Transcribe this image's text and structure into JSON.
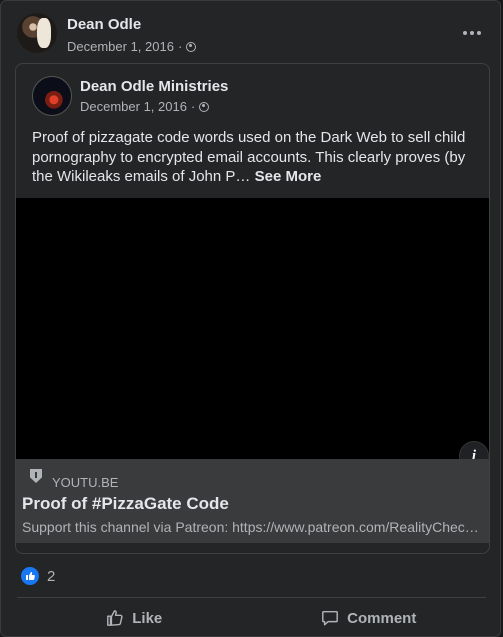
{
  "post": {
    "author": "Dean Odle",
    "date": "December 1, 2016",
    "separator": "·"
  },
  "shared": {
    "author": "Dean Odle Ministries",
    "date": "December 1, 2016",
    "separator": "·",
    "text": "Proof of pizzagate code words used on the Dark Web to sell child pornography to encrypted email accounts. This clearly proves (by the Wikileaks emails of John P…",
    "see_more": "See More"
  },
  "video": {
    "info_label": "i"
  },
  "link": {
    "domain": "YOUTU.BE",
    "title": "Proof of #PizzaGate Code",
    "description": "Support this channel via Patreon: https://www.patreon.com/RealityCheck…"
  },
  "reactions": {
    "count": "2"
  },
  "actions": {
    "like": "Like",
    "comment": "Comment"
  },
  "colors": {
    "background": "#242526",
    "like_blue": "#1877f2",
    "link_panel": "#3a3b3c"
  }
}
